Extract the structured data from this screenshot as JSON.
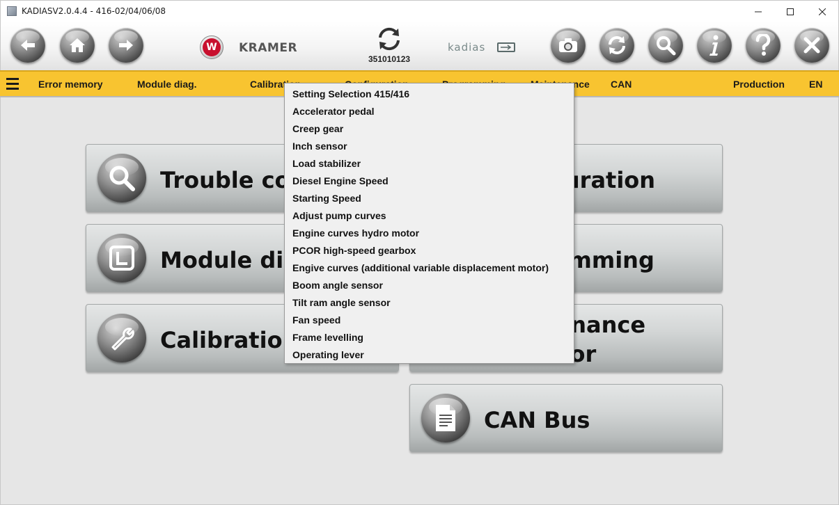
{
  "window": {
    "title": "KADIASV2.0.4.4 - 416-02/04/06/08"
  },
  "toolbar": {
    "serial_number": "351010123",
    "brand_name": "KRAMER",
    "brand_logo_letter": "W",
    "product_logo_text": "kadias"
  },
  "menubar": {
    "items": [
      "Error memory",
      "Module diag.",
      "Calibration",
      "Configuration",
      "Programming",
      "Maintenance",
      "CAN",
      "Production",
      "EN"
    ]
  },
  "tiles": {
    "trouble_codes": "Trouble codes",
    "module_diag": "Module diagnosis",
    "calibration": "Calibration",
    "configuration": "Configuration",
    "programming": "Programming",
    "maintenance_line1": "Maintenance",
    "maintenance_line2": "indicator",
    "can_bus": "CAN Bus"
  },
  "dropdown": {
    "items": [
      "Setting Selection 415/416",
      "Accelerator pedal",
      "Creep gear",
      "Inch sensor",
      "Load stabilizer",
      "Diesel Engine Speed",
      "Starting Speed",
      "Adjust pump curves",
      "Engine curves hydro motor",
      "PCOR high-speed gearbox",
      "Engive curves (additional variable displacement motor)",
      "Boom angle sensor",
      "Tilt ram angle sensor",
      "Fan speed",
      "Frame levelling",
      "Operating lever"
    ]
  },
  "colors": {
    "menubar": "#f8c430",
    "kramer_red": "#c8102e",
    "tile_text": "#111111"
  },
  "icons": [
    "back-arrow-icon",
    "home-icon",
    "forward-arrow-icon",
    "sync-icon",
    "camera-icon",
    "refresh-icon",
    "magnifier-icon",
    "info-icon",
    "help-icon",
    "close-icon",
    "wrench-icon",
    "document-icon",
    "module-icon"
  ]
}
